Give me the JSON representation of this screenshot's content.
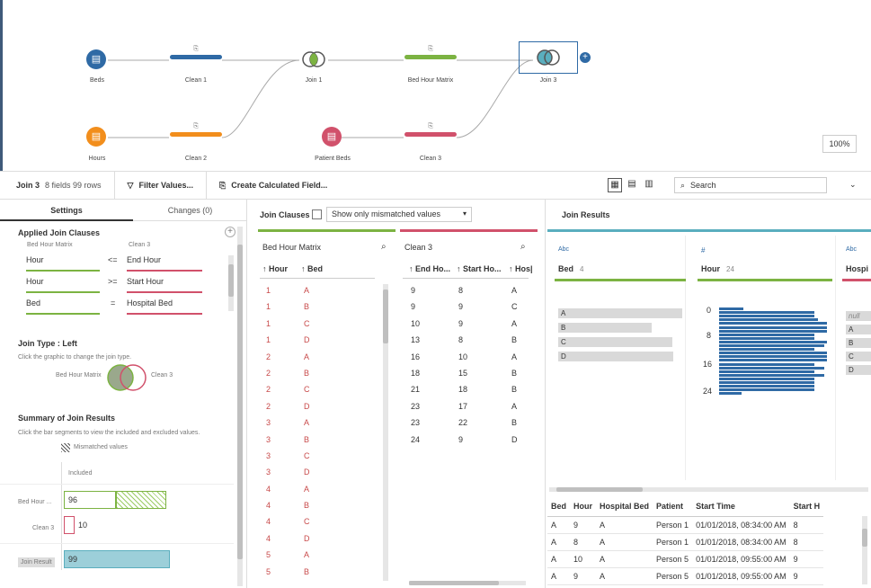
{
  "flow": {
    "nodes": {
      "beds": "Beds",
      "clean1": "Clean 1",
      "join1": "Join 1",
      "bhm": "Bed Hour Matrix",
      "join3": "Join 3",
      "hours": "Hours",
      "clean2": "Clean 2",
      "patient_beds": "Patient Beds",
      "clean3": "Clean 3"
    },
    "zoom": "100%"
  },
  "toolbar": {
    "step": "Join 3",
    "meta": "8 fields  99 rows",
    "filter": "Filter Values...",
    "calc": "Create Calculated Field...",
    "search_placeholder": "Search"
  },
  "settings": {
    "tab_settings": "Settings",
    "tab_changes": "Changes (0)",
    "applied_title": "Applied Join Clauses",
    "left_source": "Bed Hour Matrix",
    "right_source": "Clean 3",
    "clauses": [
      {
        "left": "Hour",
        "op": "<=",
        "right": "End Hour"
      },
      {
        "left": "Hour",
        "op": ">=",
        "right": "Start Hour"
      },
      {
        "left": "Bed",
        "op": "=",
        "right": "Hospital Bed"
      }
    ],
    "join_type_title": "Join Type : Left",
    "join_type_hint": "Click the graphic to change the join type.",
    "venn_left": "Bed Hour Matrix",
    "venn_right": "Clean 3",
    "summary_title": "Summary of Join Results",
    "summary_hint": "Click the bar segments to view the included and excluded values.",
    "mismatched": "Mismatched values",
    "included": "Included",
    "row1_label": "Bed Hour ...",
    "row1_value": "96",
    "row2_label": "Clean 3",
    "row2_value": "10",
    "row3_label": "Join Result",
    "row3_value": "99"
  },
  "clauses_panel": {
    "title": "Join Clauses",
    "dropdown": "Show only mismatched values",
    "left_title": "Bed Hour Matrix",
    "left_cols": [
      "↑ Hour",
      "↑ Bed"
    ],
    "left_rows": [
      [
        "1",
        "A"
      ],
      [
        "1",
        "B"
      ],
      [
        "1",
        "C"
      ],
      [
        "1",
        "D"
      ],
      [
        "2",
        "A"
      ],
      [
        "2",
        "B"
      ],
      [
        "2",
        "C"
      ],
      [
        "2",
        "D"
      ],
      [
        "3",
        "A"
      ],
      [
        "3",
        "B"
      ],
      [
        "3",
        "C"
      ],
      [
        "3",
        "D"
      ],
      [
        "4",
        "A"
      ],
      [
        "4",
        "B"
      ],
      [
        "4",
        "C"
      ],
      [
        "4",
        "D"
      ],
      [
        "5",
        "A"
      ],
      [
        "5",
        "B"
      ]
    ],
    "right_title": "Clean 3",
    "right_cols": [
      "↑ End Ho...",
      "↑ Start Ho...",
      "↑ Hos|"
    ],
    "right_rows": [
      [
        "9",
        "8",
        "A"
      ],
      [
        "9",
        "9",
        "C"
      ],
      [
        "10",
        "9",
        "A"
      ],
      [
        "13",
        "8",
        "B"
      ],
      [
        "16",
        "10",
        "A"
      ],
      [
        "18",
        "15",
        "B"
      ],
      [
        "21",
        "18",
        "B"
      ],
      [
        "23",
        "17",
        "A"
      ],
      [
        "23",
        "22",
        "B"
      ],
      [
        "24",
        "9",
        "D"
      ]
    ]
  },
  "results": {
    "title": "Join Results",
    "cards": {
      "bed": {
        "type": "Abc",
        "name": "Bed",
        "count": "4",
        "values": [
          "A",
          "B",
          "C",
          "D"
        ]
      },
      "hour": {
        "type": "#",
        "name": "Hour",
        "count": "24",
        "ticks": [
          "0",
          "8",
          "16",
          "24"
        ]
      },
      "hosp": {
        "type": "Abc",
        "name": "Hospi",
        "values": [
          "null",
          "A",
          "B",
          "C",
          "D"
        ]
      }
    },
    "columns": [
      "Bed",
      "Hour",
      "Hospital Bed",
      "Patient",
      "Start Time",
      "Start H"
    ],
    "rows": [
      [
        "A",
        "9",
        "A",
        "Person 1",
        "01/01/2018, 08:34:00 AM",
        "8"
      ],
      [
        "A",
        "8",
        "A",
        "Person 1",
        "01/01/2018, 08:34:00 AM",
        "8"
      ],
      [
        "A",
        "10",
        "A",
        "Person 5",
        "01/01/2018, 09:55:00 AM",
        "9"
      ],
      [
        "A",
        "9",
        "A",
        "Person 5",
        "01/01/2018, 09:55:00 AM",
        "9"
      ]
    ]
  },
  "colors": {
    "blue": "#2f6aa5",
    "orange": "#f28e1c",
    "green": "#7cb342",
    "red": "#d1516b",
    "teal": "#5aaebe"
  }
}
